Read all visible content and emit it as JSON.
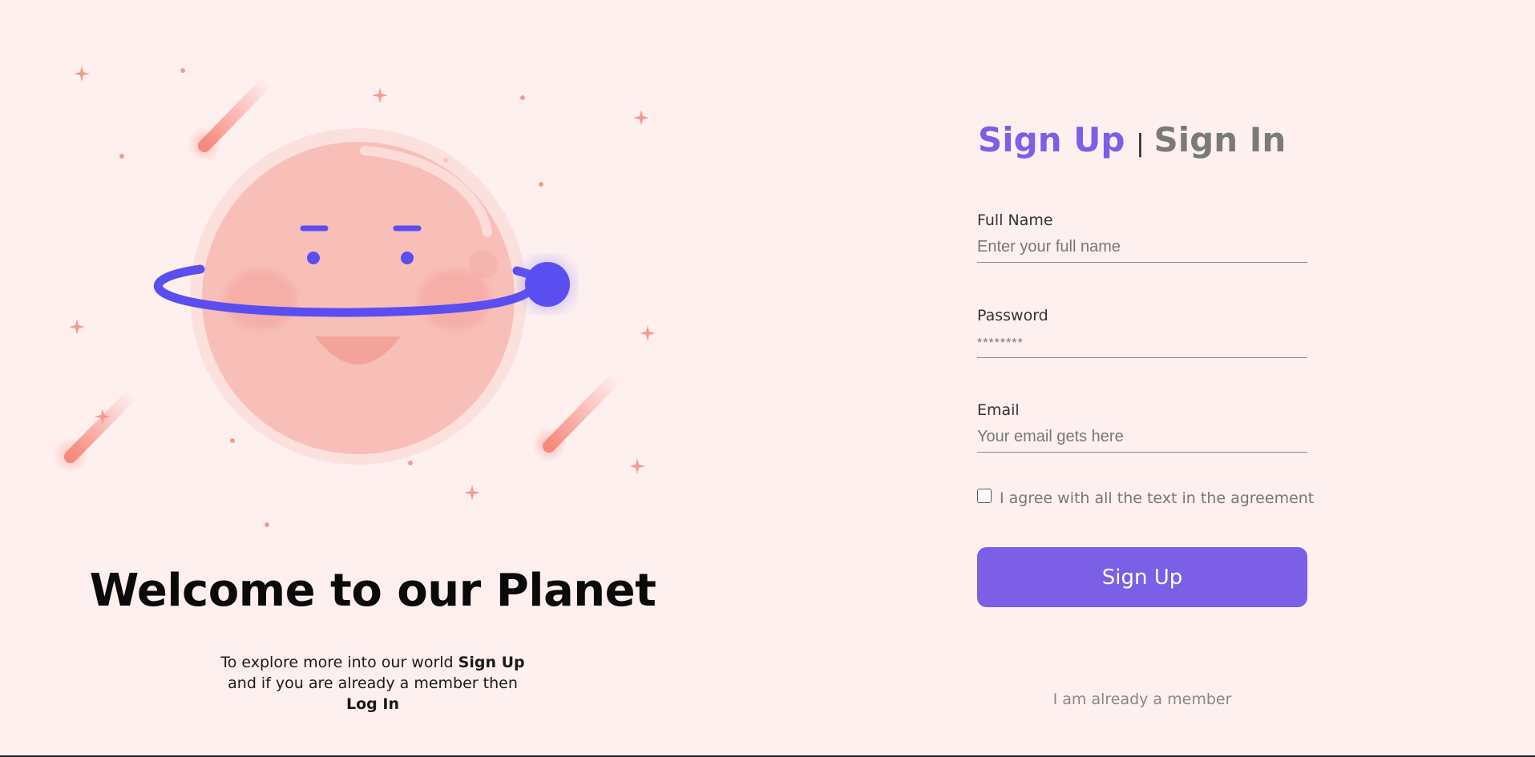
{
  "colors": {
    "background": "#fff0f0",
    "accent": "#7b5fe6",
    "planet": "#f7bfb8",
    "ring": "#5b4ef0",
    "meteor": "#f7897d",
    "star": "#f79a90"
  },
  "left": {
    "illustration_icon": "smiling-planet-illustration",
    "title": "Welcome to our Planet",
    "sub_text_1": "To explore more into our world ",
    "sub_bold_1": "Sign Up",
    "sub_text_2": " and if you are already a member then",
    "sub_bold_2": "Log In"
  },
  "tabs": {
    "signup": "Sign Up",
    "separator": "|",
    "signin": "Sign In"
  },
  "form": {
    "full_name": {
      "label": "Full Name",
      "placeholder": "Enter your full name",
      "value": ""
    },
    "password": {
      "label": "Password",
      "placeholder": "********",
      "value": ""
    },
    "email": {
      "label": "Email",
      "placeholder": "Your email gets here",
      "value": ""
    },
    "agree_label": "I agree with all the text in the agreement",
    "agree_checked": false,
    "submit_label": "Sign Up",
    "member_link": "I am already a member"
  }
}
